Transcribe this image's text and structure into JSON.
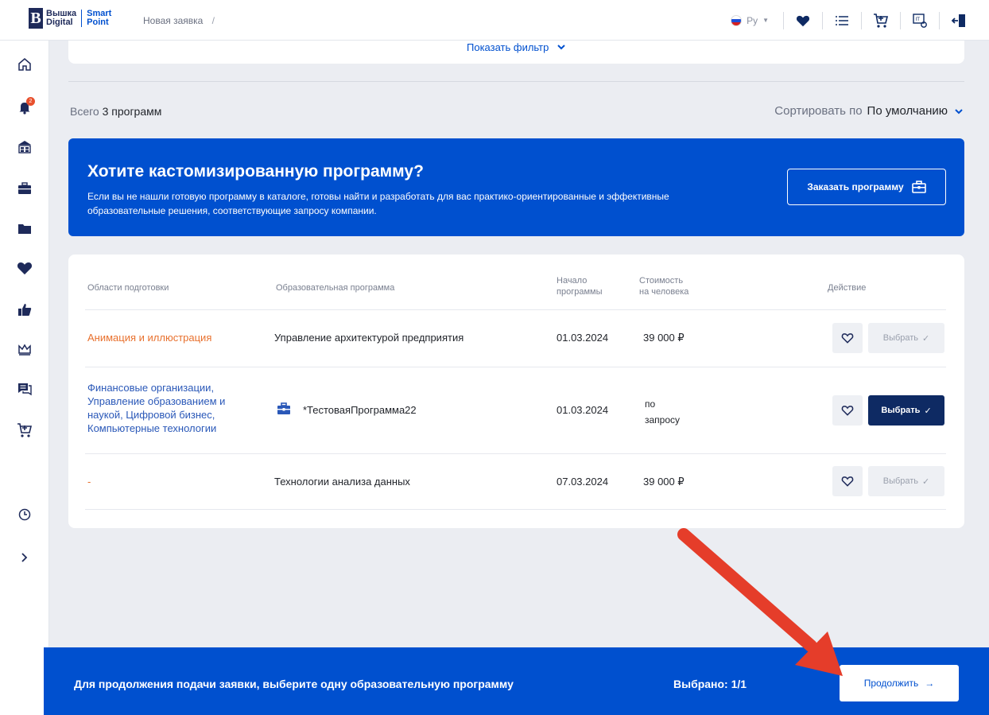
{
  "header": {
    "logo_line1": "Вышка",
    "logo_line2": "Digital",
    "logo_smart1": "Smart",
    "logo_smart2": "Point",
    "breadcrumb": "Новая заявка",
    "breadcrumb_sep": "/",
    "lang": "Ру"
  },
  "sidebar": {
    "notification_count": "2",
    "items": [
      "home-icon",
      "bell-icon",
      "university-icon",
      "briefcase-icon",
      "folder-icon",
      "heart-icon",
      "thumbs-up-icon",
      "crown-icon",
      "chat-icon",
      "cart-icon",
      "clock-icon",
      "chevron-right-icon"
    ]
  },
  "filter": {
    "label": "Показать фильтр"
  },
  "summary": {
    "total_prefix": "Всего",
    "total_value": "3 программ",
    "sort_label": "Сортировать по",
    "sort_value": "По умолчанию"
  },
  "banner": {
    "title": "Хотите кастомизированную программу?",
    "text": "Если вы не нашли готовую программу в каталоге, готовы найти и разработать для вас практико-ориентированные и эффективные образовательные решения, соответствующие запросу компании.",
    "button": "Заказать программу"
  },
  "table": {
    "headers": {
      "area": "Области подготовки",
      "program": "Образовательная программа",
      "start_l1": "Начало",
      "start_l2": "программы",
      "cost_l1": "Стоимость",
      "cost_l2": "на человека",
      "action": "Действие"
    },
    "rows": [
      {
        "area": "Анимация и иллюстрация",
        "program": "Управление архитектурой предприятия",
        "start": "01.03.2024",
        "cost": "39 000 ₽",
        "select": "Выбрать"
      },
      {
        "area": "Финансовые организации, Управление образованием и наукой, Цифровой бизнес, Компьютерные технологии",
        "program": "*ТестоваяПрограмма22",
        "start": "01.03.2024",
        "cost_l1": "по",
        "cost_l2": "запросу",
        "select": "Выбрать"
      },
      {
        "area": "-",
        "program": "Технологии анализа данных",
        "start": "07.03.2024",
        "cost": "39 000 ₽",
        "select": "Выбрать"
      }
    ]
  },
  "footer": {
    "text": "Для продолжения подачи заявки, выберите одну образовательную программу",
    "selected": "Выбрано: 1/1",
    "continue": "Продолжить"
  },
  "colors": {
    "accent": "#0050cf",
    "dark": "#0e2a63",
    "orange": "#e8702d",
    "annotation": "#e53d2a"
  }
}
